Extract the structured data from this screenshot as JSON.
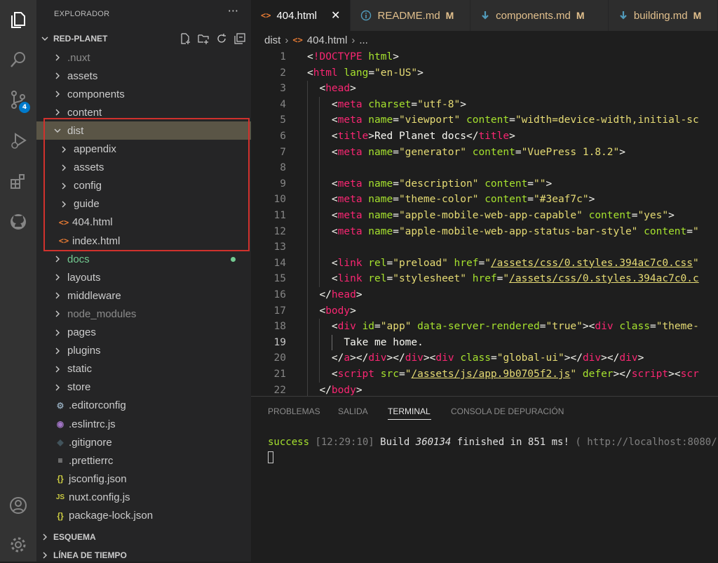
{
  "activity_bar": {
    "items": [
      {
        "icon": "files-icon"
      },
      {
        "icon": "search-icon"
      },
      {
        "icon": "source-control-icon",
        "badge": "4"
      },
      {
        "icon": "run-debug-icon"
      },
      {
        "icon": "extensions-icon"
      },
      {
        "icon": "github-icon"
      }
    ],
    "bottom": [
      {
        "icon": "account-icon"
      },
      {
        "icon": "gear-icon"
      }
    ]
  },
  "sidebar": {
    "title": "EXPLORADOR",
    "more": "···",
    "project": "RED-PLANET",
    "tree": [
      {
        "label": ".nuxt",
        "kind": "folder",
        "depth": 0,
        "dim": true
      },
      {
        "label": "assets",
        "kind": "folder",
        "depth": 0
      },
      {
        "label": "components",
        "kind": "folder",
        "depth": 0
      },
      {
        "label": "content",
        "kind": "folder",
        "depth": 0
      },
      {
        "label": "dist",
        "kind": "folder-open",
        "depth": 0,
        "selected": true
      },
      {
        "label": "appendix",
        "kind": "folder",
        "depth": 1
      },
      {
        "label": "assets",
        "kind": "folder",
        "depth": 1
      },
      {
        "label": "config",
        "kind": "folder",
        "depth": 1
      },
      {
        "label": "guide",
        "kind": "folder",
        "depth": 1
      },
      {
        "label": "404.html",
        "kind": "html",
        "depth": 1
      },
      {
        "label": "index.html",
        "kind": "html",
        "depth": 1
      },
      {
        "label": "docs",
        "kind": "folder",
        "depth": 0,
        "modified": true
      },
      {
        "label": "layouts",
        "kind": "folder",
        "depth": 0
      },
      {
        "label": "middleware",
        "kind": "folder",
        "depth": 0
      },
      {
        "label": "node_modules",
        "kind": "folder",
        "depth": 0,
        "dim": true
      },
      {
        "label": "pages",
        "kind": "folder",
        "depth": 0
      },
      {
        "label": "plugins",
        "kind": "folder",
        "depth": 0
      },
      {
        "label": "static",
        "kind": "folder",
        "depth": 0
      },
      {
        "label": "store",
        "kind": "folder",
        "depth": 0
      },
      {
        "label": ".editorconfig",
        "kind": "gear",
        "depth": 0
      },
      {
        "label": ".eslintrc.js",
        "kind": "eslint",
        "depth": 0
      },
      {
        "label": ".gitignore",
        "kind": "git",
        "depth": 0
      },
      {
        "label": ".prettierrc",
        "kind": "lines",
        "depth": 0
      },
      {
        "label": "jsconfig.json",
        "kind": "json",
        "depth": 0
      },
      {
        "label": "nuxt.config.js",
        "kind": "js",
        "depth": 0
      },
      {
        "label": "package-lock.json",
        "kind": "json",
        "depth": 0
      }
    ],
    "sections": [
      "ESQUEMA",
      "LÍNEA DE TIEMPO"
    ]
  },
  "tabs": [
    {
      "label": "404.html",
      "icon": "html-icon",
      "active": true,
      "close": "✕"
    },
    {
      "label": "README.md",
      "icon": "info-icon",
      "modified": "M"
    },
    {
      "label": "components.md",
      "icon": "markdown-icon",
      "modified": "M"
    },
    {
      "label": "building.md",
      "icon": "markdown-icon",
      "modified": "M"
    }
  ],
  "breadcrumb": {
    "folder": "dist",
    "file": "404.html",
    "rest": "..."
  },
  "code_lines": [
    {
      "n": "1",
      "indent": 0,
      "tokens": [
        [
          "t-punct",
          "<"
        ],
        [
          "t-doc",
          "!DOCTYPE"
        ],
        [
          "t-text",
          " "
        ],
        [
          "t-attr",
          "html"
        ],
        [
          "t-punct",
          ">"
        ]
      ]
    },
    {
      "n": "2",
      "indent": 0,
      "tokens": [
        [
          "t-punct",
          "<"
        ],
        [
          "t-tag",
          "html"
        ],
        [
          "t-text",
          " "
        ],
        [
          "t-attr",
          "lang"
        ],
        [
          "t-punct",
          "="
        ],
        [
          "t-str",
          "\"en-US\""
        ],
        [
          "t-punct",
          ">"
        ]
      ]
    },
    {
      "n": "3",
      "indent": 1,
      "tokens": [
        [
          "t-punct",
          "<"
        ],
        [
          "t-tag",
          "head"
        ],
        [
          "t-punct",
          ">"
        ]
      ]
    },
    {
      "n": "4",
      "indent": 2,
      "tokens": [
        [
          "t-punct",
          "<"
        ],
        [
          "t-tag",
          "meta"
        ],
        [
          "t-text",
          " "
        ],
        [
          "t-attr",
          "charset"
        ],
        [
          "t-punct",
          "="
        ],
        [
          "t-str",
          "\"utf-8\""
        ],
        [
          "t-punct",
          ">"
        ]
      ]
    },
    {
      "n": "5",
      "indent": 2,
      "tokens": [
        [
          "t-punct",
          "<"
        ],
        [
          "t-tag",
          "meta"
        ],
        [
          "t-text",
          " "
        ],
        [
          "t-attr",
          "name"
        ],
        [
          "t-punct",
          "="
        ],
        [
          "t-str",
          "\"viewport\""
        ],
        [
          "t-text",
          " "
        ],
        [
          "t-attr",
          "content"
        ],
        [
          "t-punct",
          "="
        ],
        [
          "t-str",
          "\"width=device-width,initial-sc"
        ]
      ]
    },
    {
      "n": "6",
      "indent": 2,
      "tokens": [
        [
          "t-punct",
          "<"
        ],
        [
          "t-tag",
          "title"
        ],
        [
          "t-punct",
          ">"
        ],
        [
          "t-text",
          "Red Planet docs"
        ],
        [
          "t-punct",
          "</"
        ],
        [
          "t-tag",
          "title"
        ],
        [
          "t-punct",
          ">"
        ]
      ]
    },
    {
      "n": "7",
      "indent": 2,
      "tokens": [
        [
          "t-punct",
          "<"
        ],
        [
          "t-tag",
          "meta"
        ],
        [
          "t-text",
          " "
        ],
        [
          "t-attr",
          "name"
        ],
        [
          "t-punct",
          "="
        ],
        [
          "t-str",
          "\"generator\""
        ],
        [
          "t-text",
          " "
        ],
        [
          "t-attr",
          "content"
        ],
        [
          "t-punct",
          "="
        ],
        [
          "t-str",
          "\"VuePress 1.8.2\""
        ],
        [
          "t-punct",
          ">"
        ]
      ]
    },
    {
      "n": "8",
      "indent": 2,
      "tokens": []
    },
    {
      "n": "9",
      "indent": 2,
      "tokens": [
        [
          "t-punct",
          "<"
        ],
        [
          "t-tag",
          "meta"
        ],
        [
          "t-text",
          " "
        ],
        [
          "t-attr",
          "name"
        ],
        [
          "t-punct",
          "="
        ],
        [
          "t-str",
          "\"description\""
        ],
        [
          "t-text",
          " "
        ],
        [
          "t-attr",
          "content"
        ],
        [
          "t-punct",
          "="
        ],
        [
          "t-str",
          "\"\""
        ],
        [
          "t-punct",
          ">"
        ]
      ]
    },
    {
      "n": "10",
      "indent": 2,
      "tokens": [
        [
          "t-punct",
          "<"
        ],
        [
          "t-tag",
          "meta"
        ],
        [
          "t-text",
          " "
        ],
        [
          "t-attr",
          "name"
        ],
        [
          "t-punct",
          "="
        ],
        [
          "t-str",
          "\"theme-color\""
        ],
        [
          "t-text",
          " "
        ],
        [
          "t-attr",
          "content"
        ],
        [
          "t-punct",
          "="
        ],
        [
          "t-str",
          "\"#3eaf7c\""
        ],
        [
          "t-punct",
          ">"
        ]
      ]
    },
    {
      "n": "11",
      "indent": 2,
      "tokens": [
        [
          "t-punct",
          "<"
        ],
        [
          "t-tag",
          "meta"
        ],
        [
          "t-text",
          " "
        ],
        [
          "t-attr",
          "name"
        ],
        [
          "t-punct",
          "="
        ],
        [
          "t-str",
          "\"apple-mobile-web-app-capable\""
        ],
        [
          "t-text",
          " "
        ],
        [
          "t-attr",
          "content"
        ],
        [
          "t-punct",
          "="
        ],
        [
          "t-str",
          "\"yes\""
        ],
        [
          "t-punct",
          ">"
        ]
      ]
    },
    {
      "n": "12",
      "indent": 2,
      "tokens": [
        [
          "t-punct",
          "<"
        ],
        [
          "t-tag",
          "meta"
        ],
        [
          "t-text",
          " "
        ],
        [
          "t-attr",
          "name"
        ],
        [
          "t-punct",
          "="
        ],
        [
          "t-str",
          "\"apple-mobile-web-app-status-bar-style\""
        ],
        [
          "t-text",
          " "
        ],
        [
          "t-attr",
          "content"
        ],
        [
          "t-punct",
          "="
        ],
        [
          "t-str",
          "\""
        ]
      ]
    },
    {
      "n": "13",
      "indent": 2,
      "tokens": []
    },
    {
      "n": "14",
      "indent": 2,
      "tokens": [
        [
          "t-punct",
          "<"
        ],
        [
          "t-tag",
          "link"
        ],
        [
          "t-text",
          " "
        ],
        [
          "t-attr",
          "rel"
        ],
        [
          "t-punct",
          "="
        ],
        [
          "t-str",
          "\"preload\""
        ],
        [
          "t-text",
          " "
        ],
        [
          "t-attr",
          "href"
        ],
        [
          "t-punct",
          "="
        ],
        [
          "t-str",
          "\""
        ],
        [
          "t-str-u",
          "/assets/css/0.styles.394ac7c0.css"
        ],
        [
          "t-str",
          "\""
        ]
      ]
    },
    {
      "n": "15",
      "indent": 2,
      "tokens": [
        [
          "t-punct",
          "<"
        ],
        [
          "t-tag",
          "link"
        ],
        [
          "t-text",
          " "
        ],
        [
          "t-attr",
          "rel"
        ],
        [
          "t-punct",
          "="
        ],
        [
          "t-str",
          "\"stylesheet\""
        ],
        [
          "t-text",
          " "
        ],
        [
          "t-attr",
          "href"
        ],
        [
          "t-punct",
          "="
        ],
        [
          "t-str",
          "\""
        ],
        [
          "t-str-u",
          "/assets/css/0.styles.394ac7c0.c"
        ]
      ]
    },
    {
      "n": "16",
      "indent": 1,
      "tokens": [
        [
          "t-punct",
          "</"
        ],
        [
          "t-tag",
          "head"
        ],
        [
          "t-punct",
          ">"
        ]
      ]
    },
    {
      "n": "17",
      "indent": 1,
      "tokens": [
        [
          "t-punct",
          "<"
        ],
        [
          "t-tag",
          "body"
        ],
        [
          "t-punct",
          ">"
        ]
      ]
    },
    {
      "n": "18",
      "indent": 2,
      "tokens": [
        [
          "t-punct",
          "<"
        ],
        [
          "t-tag",
          "div"
        ],
        [
          "t-text",
          " "
        ],
        [
          "t-attr",
          "id"
        ],
        [
          "t-punct",
          "="
        ],
        [
          "t-str",
          "\"app\""
        ],
        [
          "t-text",
          " "
        ],
        [
          "t-attr",
          "data-server-rendered"
        ],
        [
          "t-punct",
          "="
        ],
        [
          "t-str",
          "\"true\""
        ],
        [
          "t-punct",
          "><"
        ],
        [
          "t-tag",
          "div"
        ],
        [
          "t-text",
          " "
        ],
        [
          "t-attr",
          "class"
        ],
        [
          "t-punct",
          "="
        ],
        [
          "t-str",
          "\"theme-"
        ]
      ]
    },
    {
      "n": "19",
      "indent": 3,
      "tokens": [
        [
          "t-text",
          "Take me home."
        ]
      ]
    },
    {
      "n": "20",
      "indent": 2,
      "tokens": [
        [
          "t-punct",
          "</"
        ],
        [
          "t-tag",
          "a"
        ],
        [
          "t-punct",
          "></"
        ],
        [
          "t-tag",
          "div"
        ],
        [
          "t-punct",
          "></"
        ],
        [
          "t-tag",
          "div"
        ],
        [
          "t-punct",
          "><"
        ],
        [
          "t-tag",
          "div"
        ],
        [
          "t-text",
          " "
        ],
        [
          "t-attr",
          "class"
        ],
        [
          "t-punct",
          "="
        ],
        [
          "t-str",
          "\"global-ui\""
        ],
        [
          "t-punct",
          "></"
        ],
        [
          "t-tag",
          "div"
        ],
        [
          "t-punct",
          "></"
        ],
        [
          "t-tag",
          "div"
        ],
        [
          "t-punct",
          ">"
        ]
      ]
    },
    {
      "n": "21",
      "indent": 2,
      "tokens": [
        [
          "t-punct",
          "<"
        ],
        [
          "t-tag",
          "script"
        ],
        [
          "t-text",
          " "
        ],
        [
          "t-attr",
          "src"
        ],
        [
          "t-punct",
          "="
        ],
        [
          "t-str",
          "\""
        ],
        [
          "t-str-u",
          "/assets/js/app.9b0705f2.js"
        ],
        [
          "t-str",
          "\""
        ],
        [
          "t-text",
          " "
        ],
        [
          "t-attr",
          "defer"
        ],
        [
          "t-punct",
          "></"
        ],
        [
          "t-tag",
          "script"
        ],
        [
          "t-punct",
          "><"
        ],
        [
          "t-tag",
          "scr"
        ]
      ]
    },
    {
      "n": "22",
      "indent": 1,
      "tokens": [
        [
          "t-punct",
          "</"
        ],
        [
          "t-tag",
          "body"
        ],
        [
          "t-punct",
          ">"
        ]
      ]
    }
  ],
  "panel": {
    "tabs": [
      "PROBLEMAS",
      "SALIDA",
      "TERMINAL",
      "CONSOLA DE DEPURACIÓN"
    ],
    "active_tab": "TERMINAL",
    "terminal": {
      "status": "success",
      "time": "[12:29:10]",
      "msg1": " Build ",
      "build_id": "360134",
      "msg2": " finished in 851 ms! ",
      "url": "( http://localhost:8080/"
    }
  },
  "colors": {
    "selection": "#5a5546",
    "highlight_box": "#d0312d",
    "badge": "#007acc",
    "modified_dot": "#73c991"
  }
}
